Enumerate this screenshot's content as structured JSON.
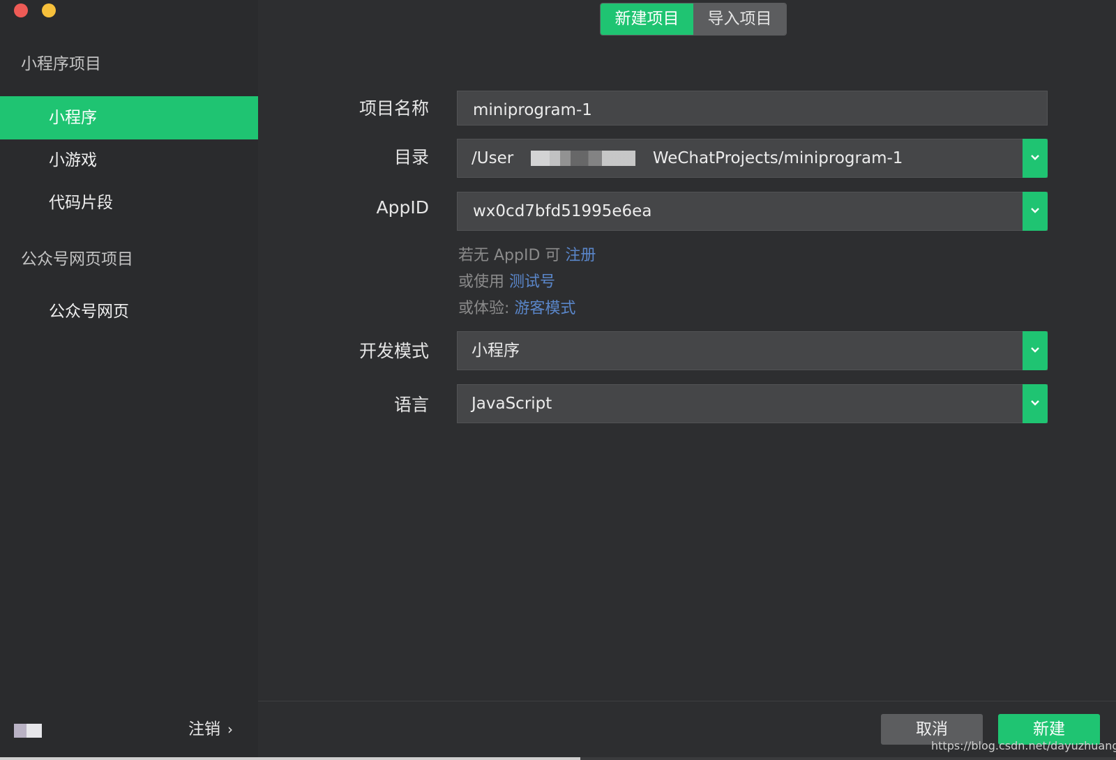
{
  "window": {
    "title": ""
  },
  "sidebar": {
    "section_mini": "小程序项目",
    "items_mini": [
      {
        "label": "小程序",
        "active": true
      },
      {
        "label": "小游戏",
        "active": false
      },
      {
        "label": "代码片段",
        "active": false
      }
    ],
    "section_official": "公众号网页项目",
    "items_official": [
      {
        "label": "公众号网页",
        "active": false
      }
    ],
    "logout_label": "注销",
    "logout_chevron": "›"
  },
  "header": {
    "tabs": [
      {
        "label": "新建项目",
        "active": true
      },
      {
        "label": "导入项目",
        "active": false
      }
    ]
  },
  "form": {
    "project_name": {
      "label": "项目名称",
      "value": "miniprogram-1"
    },
    "directory": {
      "label": "目录",
      "value_prefix": "/User",
      "value_suffix": "WeChatProjects/miniprogram-1"
    },
    "appid": {
      "label": "AppID",
      "value": "wx0cd7bfd51995e6ea"
    },
    "help": {
      "line1_prefix": "若无 AppID 可 ",
      "line1_link": "注册",
      "line2_prefix": "或使用 ",
      "line2_link": "测试号",
      "line3_prefix": "或体验:  ",
      "line3_link": "游客模式"
    },
    "dev_mode": {
      "label": "开发模式",
      "value": "小程序"
    },
    "language": {
      "label": "语言",
      "value": "JavaScript"
    }
  },
  "footer": {
    "cancel_label": "取消",
    "create_label": "新建"
  },
  "watermark": "https://blog.csdn.net/dayuzhuangzhi",
  "colors": {
    "accent": "#1fc472",
    "sidebar_bg": "#2a2b2d",
    "main_bg": "#2d2e30",
    "field_bg": "#454648",
    "link": "#5a86c9",
    "help_text": "#8b8b8b",
    "close_light": "#ee5b56",
    "minimize_light": "#f6c03b"
  },
  "icons": {
    "dropdown": "chevron-down-icon",
    "logout_arrow": "chevron-right-icon"
  }
}
